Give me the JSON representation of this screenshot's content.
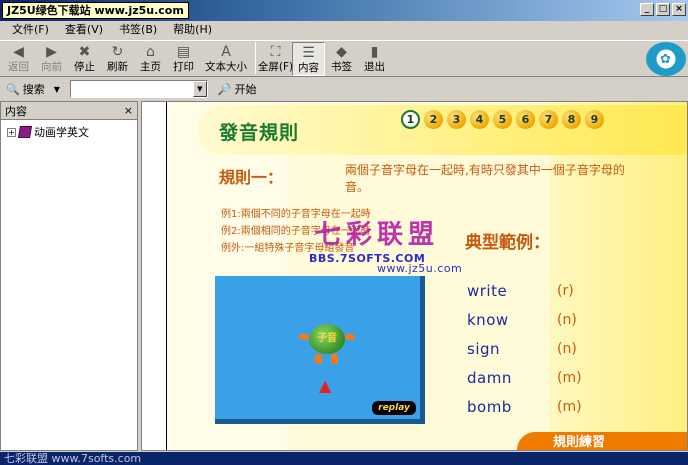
{
  "window": {
    "site_badge": "JZ5U绿色下载站 www.jz5u.com"
  },
  "menu": [
    "文件(F)",
    "查看(V)",
    "书签(B)",
    "帮助(H)"
  ],
  "toolbar": {
    "buttons": [
      {
        "label": "返回",
        "icon": "back-arrow-icon",
        "disabled": true
      },
      {
        "label": "向前",
        "icon": "forward-arrow-icon",
        "disabled": true
      },
      {
        "label": "停止",
        "icon": "stop-icon",
        "disabled": false
      },
      {
        "label": "刷新",
        "icon": "refresh-icon",
        "disabled": false
      },
      {
        "label": "主页",
        "icon": "home-icon",
        "disabled": false
      },
      {
        "label": "打印",
        "icon": "print-icon",
        "disabled": false
      },
      {
        "label": "文本大小",
        "icon": "text-size-icon",
        "disabled": false
      },
      {
        "label": "全屏(F)",
        "icon": "fullscreen-icon",
        "disabled": false
      },
      {
        "label": "内容",
        "icon": "contents-icon",
        "disabled": false,
        "active": true
      },
      {
        "label": "书签",
        "icon": "bookmark-icon",
        "disabled": false
      },
      {
        "label": "退出",
        "icon": "exit-icon",
        "disabled": false
      }
    ]
  },
  "searchbar": {
    "label": "搜索",
    "value": "",
    "go_label": "开始"
  },
  "left_pane": {
    "header": "内容",
    "close_glyph": "×",
    "tree_items": [
      {
        "label": "动画学英文",
        "expander": "+"
      }
    ]
  },
  "lesson": {
    "title": "發音規則",
    "numbers": [
      "1",
      "2",
      "3",
      "4",
      "5",
      "6",
      "7",
      "8",
      "9"
    ],
    "active_number": "1",
    "rule_title": "規則一：",
    "rule_text": "兩個子音字母在一起時,有時只發其中一個子音字母的音。",
    "examples": [
      "例1:兩個不同的子音字母在一起時",
      "例2:兩個相同的子音字母在一起時",
      "例外:一組特殊子音字母組發音"
    ],
    "typical_title": "典型範例：",
    "ball_text": "子音",
    "replay_label": "replay",
    "words": [
      {
        "word": "write",
        "sound": "(r)"
      },
      {
        "word": "know",
        "sound": "(n)"
      },
      {
        "word": "sign",
        "sound": "(n)"
      },
      {
        "word": "damn",
        "sound": "(m)"
      },
      {
        "word": "bomb",
        "sound": "(m)"
      }
    ],
    "practice_tab": "規則練習"
  },
  "watermark": {
    "brand": "七彩联盟",
    "site1": "BBS.7SOFTS.COM",
    "site2": "www.jz5u.com"
  },
  "statusbar": "七彩联盟 www.7softs.com"
}
